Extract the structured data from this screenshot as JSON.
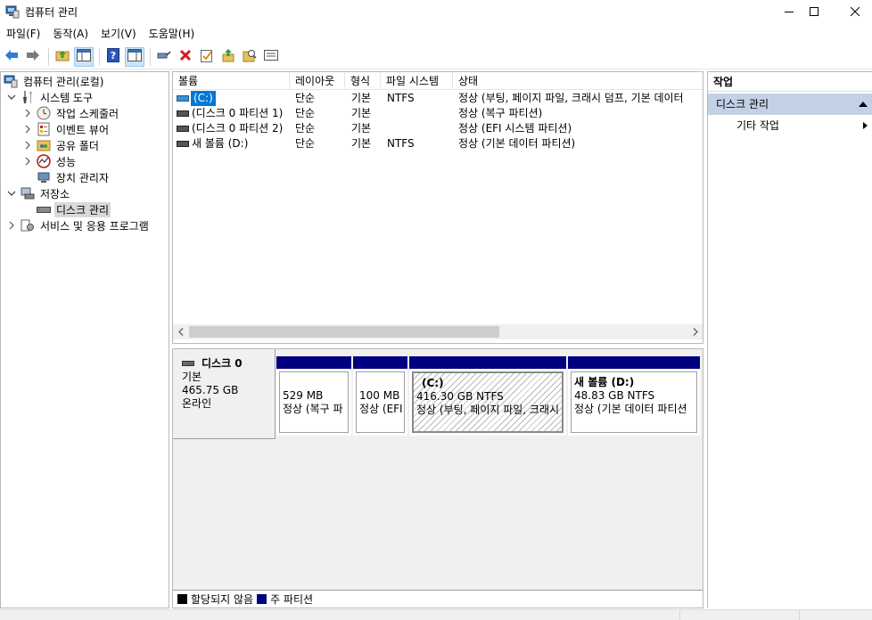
{
  "window": {
    "title": "컴퓨터 관리",
    "icon": "computer-management-icon"
  },
  "menu": [
    "파일(F)",
    "동작(A)",
    "보기(V)",
    "도움말(H)"
  ],
  "toolbar": {
    "buttons": [
      "back-icon",
      "forward-icon",
      "up-folder-icon",
      "show-hide-tree-icon",
      "help-icon",
      "properties-view-icon",
      "connect-icon",
      "delete-icon",
      "check-icon",
      "export-icon",
      "search-icon",
      "list-icon"
    ]
  },
  "tree": {
    "root": "컴퓨터 관리(로컬)",
    "system_tools": "시스템 도구",
    "task_scheduler": "작업 스케줄러",
    "event_viewer": "이벤트 뷰어",
    "shared_folders": "공유 폴더",
    "performance": "성능",
    "device_manager": "장치 관리자",
    "storage": "저장소",
    "disk_management": "디스크 관리",
    "services_apps": "서비스 및 응용 프로그램"
  },
  "volumes": {
    "columns": [
      "볼륨",
      "레이아웃",
      "형식",
      "파일 시스템",
      "상태"
    ],
    "rows": [
      {
        "volume": "(C:)",
        "layout": "단순",
        "type": "기본",
        "fs": "NTFS",
        "status": "정상 (부팅, 페이지 파일, 크래시 덤프, 기본 데이터"
      },
      {
        "volume": "(디스크 0 파티션 1)",
        "layout": "단순",
        "type": "기본",
        "fs": "",
        "status": "정상 (복구 파티션)"
      },
      {
        "volume": "(디스크 0 파티션 2)",
        "layout": "단순",
        "type": "기본",
        "fs": "",
        "status": "정상 (EFI 시스템 파티션)"
      },
      {
        "volume": "새 볼륨 (D:)",
        "layout": "단순",
        "type": "기본",
        "fs": "NTFS",
        "status": "정상 (기본 데이터 파티션)"
      }
    ]
  },
  "disk": {
    "name": "디스크 0",
    "type": "기본",
    "size": "465.75 GB",
    "state": "온라인",
    "partitions": [
      {
        "name": "",
        "size": "529 MB",
        "status": "정상 (복구 파"
      },
      {
        "name": "",
        "size": "100 MB",
        "status": "정상 (EFI"
      },
      {
        "name": "(C:)",
        "size": "416.30 GB NTFS",
        "status": "정상 (부팅, 페이지 파일, 크래시"
      },
      {
        "name": "새 볼륨  (D:)",
        "size": "48.83 GB NTFS",
        "status": "정상 (기본 데이터 파티션"
      }
    ]
  },
  "legend": {
    "unallocated": "할당되지 않음",
    "primary": "주 파티션",
    "unallocated_color": "#000000",
    "primary_color": "#000080"
  },
  "actions": {
    "title": "작업",
    "section": "디스크 관리",
    "more": "기타 작업"
  }
}
